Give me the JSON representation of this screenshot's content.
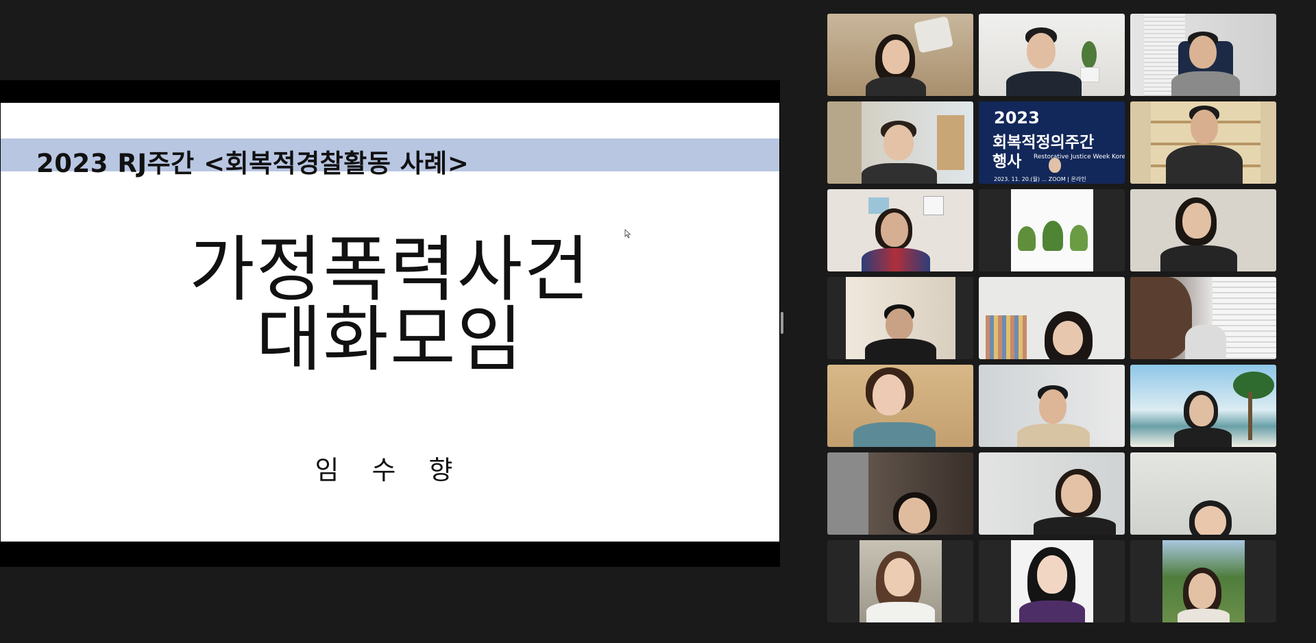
{
  "slide": {
    "banner": "2023 RJ주간 <회복적경찰활동 사례>",
    "title_line1": "가정폭력사건",
    "title_line2": "대화모임",
    "author": "임 수 향"
  },
  "gallery": {
    "tiles": [
      {
        "id": "p1",
        "active": true
      },
      {
        "id": "p2"
      },
      {
        "id": "p3"
      },
      {
        "id": "p4"
      },
      {
        "id": "p5",
        "poster": {
          "year": "2023",
          "line1": "회복적정의주간",
          "line2": "행사",
          "subtitle": "Restorative Justice Week Korea",
          "date": "2023. 11. 20.(월) ... ZOOM | 온라인"
        }
      },
      {
        "id": "p6"
      },
      {
        "id": "p7"
      },
      {
        "id": "p8"
      },
      {
        "id": "p9"
      },
      {
        "id": "p10"
      },
      {
        "id": "p11"
      },
      {
        "id": "p12"
      },
      {
        "id": "p13"
      },
      {
        "id": "p14"
      },
      {
        "id": "p15"
      },
      {
        "id": "p16"
      },
      {
        "id": "p17"
      },
      {
        "id": "p18"
      },
      {
        "id": "p19"
      },
      {
        "id": "p20"
      },
      {
        "id": "p21"
      }
    ]
  },
  "colors": {
    "active_speaker": "#5fc24f",
    "banner": "#b8c6e2",
    "background": "#1a1a1a"
  }
}
